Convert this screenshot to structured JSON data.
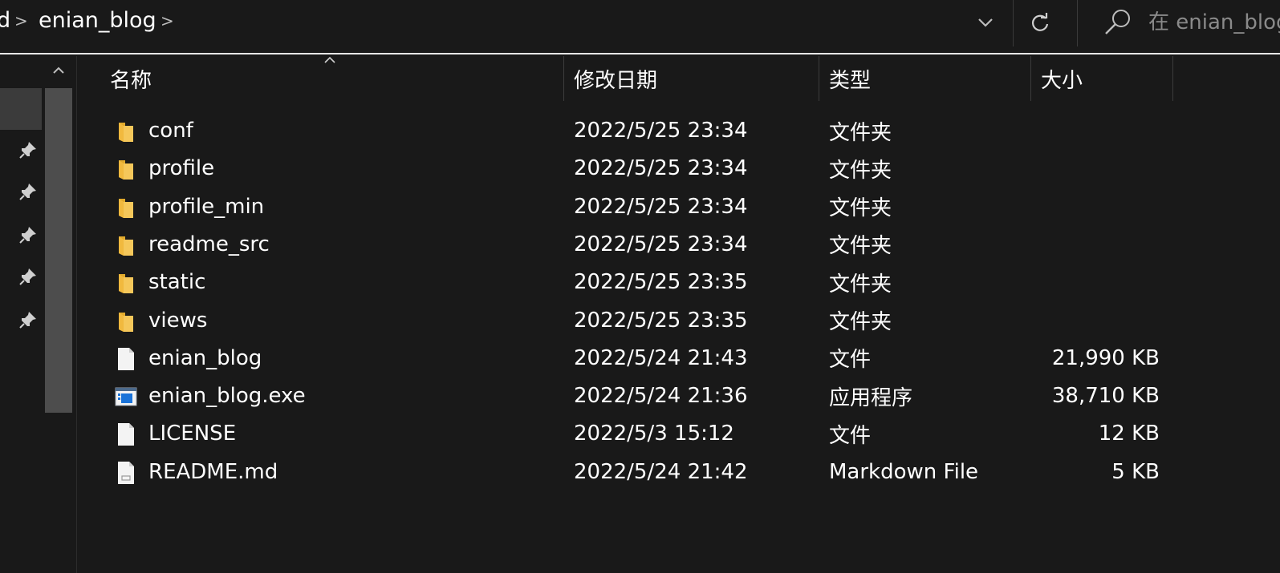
{
  "address_bar": {
    "partial_crumb": "d",
    "current_folder": "enian_blog",
    "separator": ">"
  },
  "search": {
    "placeholder": "在 enian_blog 中搜索"
  },
  "nav": {
    "pins": [
      "pin-icon",
      "pin-icon",
      "pin-icon",
      "pin-icon",
      "pin-icon"
    ]
  },
  "columns": {
    "name": "名称",
    "date": "修改日期",
    "type": "类型",
    "size": "大小"
  },
  "files": [
    {
      "name": "conf",
      "date": "2022/5/25 23:34",
      "type": "文件夹",
      "size": "",
      "icon": "folder-icon"
    },
    {
      "name": "profile",
      "date": "2022/5/25 23:34",
      "type": "文件夹",
      "size": "",
      "icon": "folder-icon"
    },
    {
      "name": "profile_min",
      "date": "2022/5/25 23:34",
      "type": "文件夹",
      "size": "",
      "icon": "folder-icon"
    },
    {
      "name": "readme_src",
      "date": "2022/5/25 23:34",
      "type": "文件夹",
      "size": "",
      "icon": "folder-icon"
    },
    {
      "name": "static",
      "date": "2022/5/25 23:35",
      "type": "文件夹",
      "size": "",
      "icon": "folder-icon"
    },
    {
      "name": "views",
      "date": "2022/5/25 23:35",
      "type": "文件夹",
      "size": "",
      "icon": "folder-icon"
    },
    {
      "name": "enian_blog",
      "date": "2022/5/24 21:43",
      "type": "文件",
      "size": "21,990 KB",
      "icon": "file-icon"
    },
    {
      "name": "enian_blog.exe",
      "date": "2022/5/24 21:36",
      "type": "应用程序",
      "size": "38,710 KB",
      "icon": "application-icon"
    },
    {
      "name": "LICENSE",
      "date": "2022/5/3 15:12",
      "type": "文件",
      "size": "12 KB",
      "icon": "file-icon"
    },
    {
      "name": "README.md",
      "date": "2022/5/24 21:42",
      "type": "Markdown File",
      "size": "5 KB",
      "icon": "markdown-file-icon"
    }
  ],
  "colors": {
    "background": "#191919",
    "folder": "#f5c75a",
    "selected_nav": "#3b3b3b"
  }
}
